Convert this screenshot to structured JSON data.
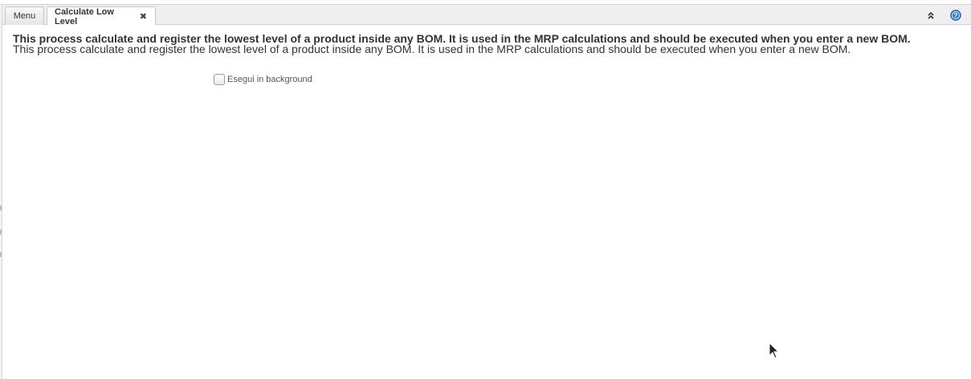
{
  "tabs": [
    {
      "label": "Menu",
      "active": false
    },
    {
      "label": "Calculate Low Level",
      "active": true,
      "closable": true
    }
  ],
  "toolbar": {
    "collapse_icon": "double-chevron-up-icon",
    "help_icon": "help-icon"
  },
  "process": {
    "title": "This process calculate and register the lowest level of a product inside any BOM. It is used in the MRP calculations and should be executed when you enter a new BOM.",
    "description": "This process calculate and register the lowest level of a product inside any BOM. It is used in the MRP calculations and should be executed when you enter a new BOM."
  },
  "options": {
    "run_in_background_label": "Esegui in background",
    "run_in_background_checked": false
  },
  "colors": {
    "accent_help": "#3a7bd5",
    "text": "#333333"
  }
}
